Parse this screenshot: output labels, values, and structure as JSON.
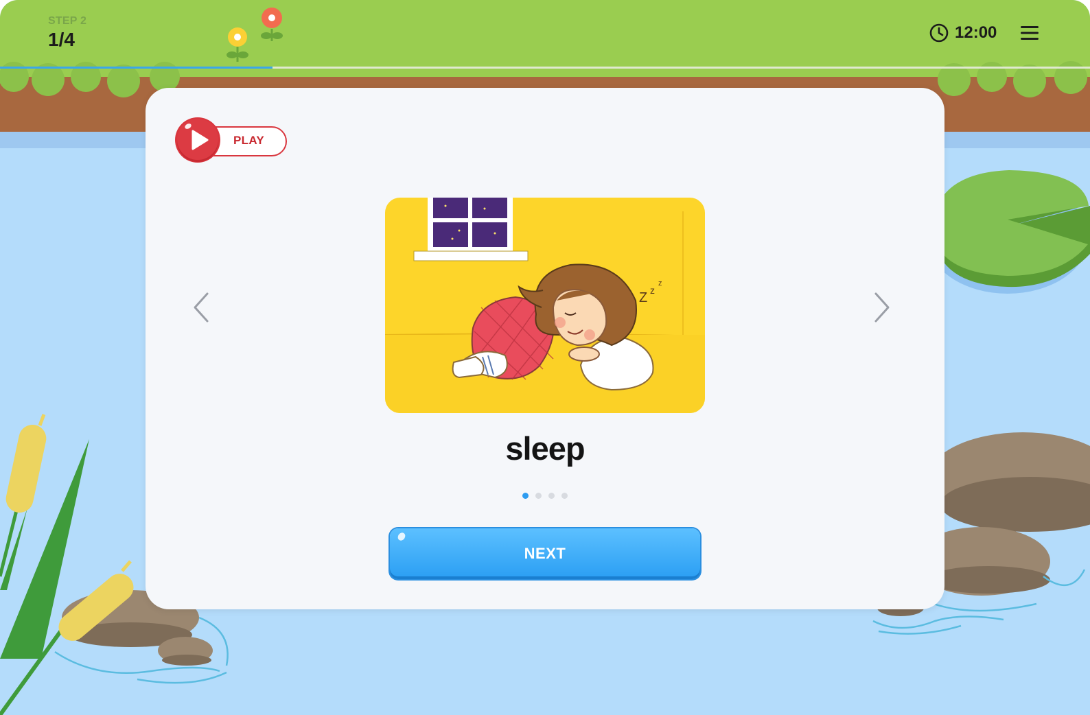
{
  "header": {
    "step_label": "STEP 2",
    "step_progress": "1/4",
    "timer": "12:00",
    "timer_icon": "clock-icon",
    "menu_icon": "hamburger-menu-icon",
    "progress_fraction": 0.25
  },
  "card": {
    "play_label": "PLAY",
    "play_icon": "play-icon",
    "prev_icon": "chevron-left-icon",
    "next_arrow_icon": "chevron-right-icon",
    "illustration_icon": "sleeping-girl-illustration",
    "word": "sleep",
    "pager": {
      "total": 4,
      "current": 1
    },
    "next_label": "NEXT"
  },
  "colors": {
    "grass": "#9acd50",
    "dirt": "#a8683f",
    "water": "#b4dcfb",
    "accent_blue": "#2e9cf0",
    "play_red": "#d9363e",
    "illustration_bg": "#fdd52a"
  }
}
